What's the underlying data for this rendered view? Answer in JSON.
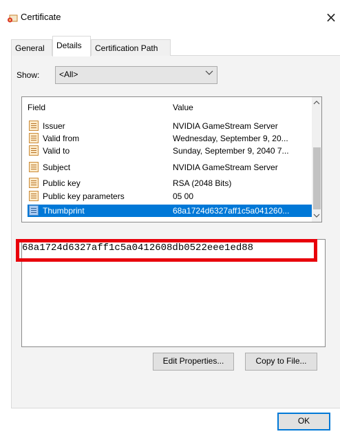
{
  "window": {
    "title": "Certificate",
    "close_glyph": "×"
  },
  "tabs": [
    {
      "label": "General",
      "selected": false
    },
    {
      "label": "Details",
      "selected": true
    },
    {
      "label": "Certification Path",
      "selected": false
    }
  ],
  "show": {
    "label": "Show:",
    "value": "<All>"
  },
  "list": {
    "headers": {
      "field": "Field",
      "value": "Value"
    },
    "rows": [
      {
        "field": "Issuer",
        "value": "NVIDIA GameStream Server"
      },
      {
        "field": "Valid from",
        "value": "Wednesday, September 9, 20..."
      },
      {
        "field": "Valid to",
        "value": "Sunday, September 9, 2040 7..."
      },
      {
        "field": "Subject",
        "value": "NVIDIA GameStream Server"
      },
      {
        "field": "Public key",
        "value": "RSA (2048 Bits)"
      },
      {
        "field": "Public key parameters",
        "value": "05 00"
      },
      {
        "field": "Thumbprint",
        "value": "68a1724d6327aff1c5a041260..."
      }
    ],
    "selected_index": 6
  },
  "detail_value": "68a1724d6327aff1c5a0412608db0522eee1ed88",
  "buttons": {
    "edit_properties": "Edit Properties...",
    "copy_to_file": "Copy to File...",
    "ok": "OK"
  },
  "colors": {
    "selection": "#0078d7",
    "highlight_box": "#e8000b"
  },
  "icons": {
    "app": "certificate-icon",
    "row": "certificate-field-icon"
  }
}
